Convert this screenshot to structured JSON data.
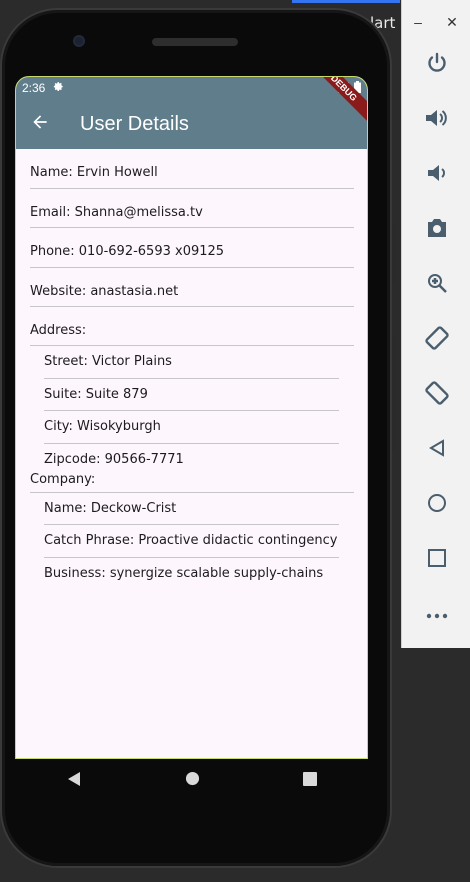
{
  "window": {
    "title_fragment": "lart",
    "minimize_glyph": "–",
    "close_glyph": "✕"
  },
  "status_bar": {
    "time": "2:36",
    "settings_icon": "gear-icon",
    "signal_icon": "signal-icon",
    "battery_icon": "battery-icon"
  },
  "app_bar": {
    "title": "User Details",
    "back_icon": "arrow-back-icon",
    "debug_banner": "DEBUG"
  },
  "user": {
    "name": "Name: Ervin Howell",
    "email": "Email: Shanna@melissa.tv",
    "phone": "Phone: 010-692-6593 x09125",
    "website": "Website: anastasia.net",
    "address_label": "Address:",
    "address": {
      "street": "Street: Victor Plains",
      "suite": "Suite: Suite 879",
      "city": "City: Wisokyburgh",
      "zipcode": "Zipcode: 90566-7771"
    },
    "company_label": "Company:",
    "company": {
      "name": "Name: Deckow-Crist",
      "catch_phrase": "Catch Phrase: Proactive didactic contingency",
      "business": "Business: synergize scalable supply-chains"
    }
  },
  "nav_bar": {
    "back": "triangle-back-icon",
    "home": "circle-home-icon",
    "recents": "square-recents-icon"
  },
  "emulator_toolbar": [
    "power-icon",
    "volume-up-icon",
    "volume-down-icon",
    "camera-icon",
    "zoom-icon",
    "rotate-left-icon",
    "rotate-right-icon",
    "back-icon",
    "home-icon",
    "overview-icon",
    "more-icon"
  ],
  "colors": {
    "app_bar": "#607d8b",
    "screen_bg": "#fdf7fd",
    "divider": "#c9c5cd"
  }
}
